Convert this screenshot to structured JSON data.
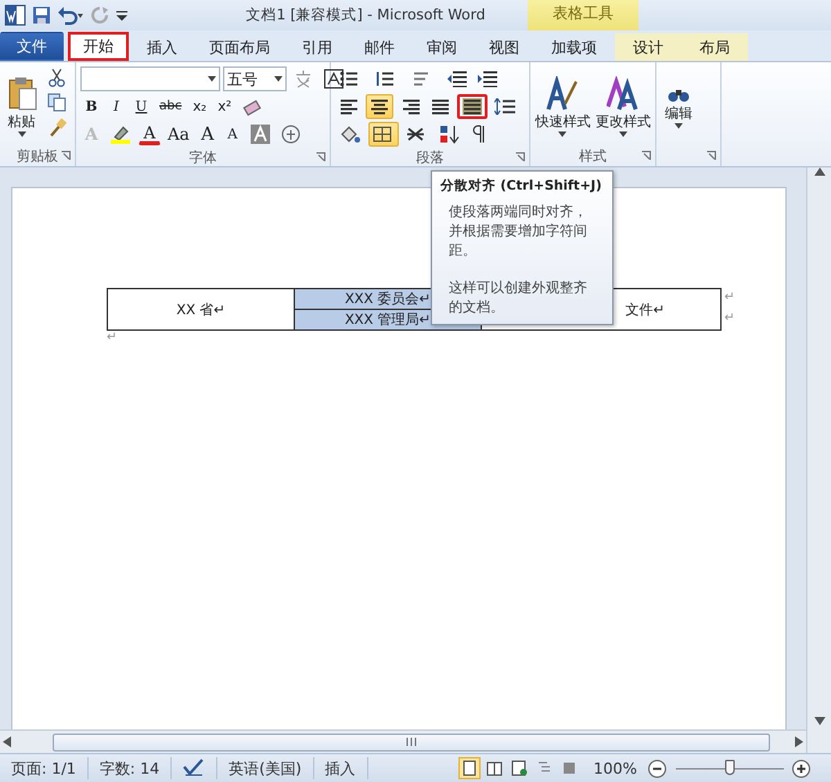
{
  "title_bar": {
    "title": "文档1 [兼容模式] - Microsoft Word",
    "contextual_group": "表格工具"
  },
  "tabs": [
    {
      "label": "文件",
      "kind": "file",
      "selected": false
    },
    {
      "label": "开始",
      "kind": "normal",
      "selected": true
    },
    {
      "label": "插入",
      "kind": "normal",
      "selected": false
    },
    {
      "label": "页面布局",
      "kind": "normal",
      "selected": false
    },
    {
      "label": "引用",
      "kind": "normal",
      "selected": false
    },
    {
      "label": "邮件",
      "kind": "normal",
      "selected": false
    },
    {
      "label": "审阅",
      "kind": "normal",
      "selected": false
    },
    {
      "label": "视图",
      "kind": "normal",
      "selected": false
    },
    {
      "label": "加载项",
      "kind": "normal",
      "selected": false
    },
    {
      "label": "设计",
      "kind": "contextual",
      "selected": false
    },
    {
      "label": "布局",
      "kind": "contextual",
      "selected": false
    }
  ],
  "ribbon": {
    "clipboard": {
      "label": "剪贴板",
      "paste": "粘贴"
    },
    "font": {
      "label": "字体",
      "size": "五号",
      "format_buttons": [
        "B",
        "I",
        "U",
        "abc",
        "x₂",
        "x²"
      ],
      "grow": "A",
      "shrink": "A",
      "case": "Aa",
      "font_color_letter": "A",
      "char_shade": "A"
    },
    "paragraph": {
      "label": "段落",
      "alignments": [
        {
          "kind": "left",
          "selected": false,
          "hovered": false
        },
        {
          "kind": "center",
          "selected": true,
          "hovered": false
        },
        {
          "kind": "right",
          "selected": false,
          "hovered": false
        },
        {
          "kind": "justify",
          "selected": false,
          "hovered": false
        },
        {
          "kind": "distributed",
          "selected": false,
          "hovered": true
        }
      ],
      "borders_selected": true
    },
    "styles": {
      "label": "样式",
      "buttons": [
        "快速样式",
        "更改样式"
      ]
    },
    "editing": {
      "label": "编辑"
    }
  },
  "tooltip": {
    "title": "分散对齐 (Ctrl+Shift+J)",
    "description": "使段落两端同时对齐，并根据需要增加字符间距。",
    "note": "这样可以创建外观整齐的文档。"
  },
  "table": {
    "left": {
      "text": "XX 省↵",
      "selected": false
    },
    "middle": [
      {
        "text": "XXX 委员会↵",
        "selected": true
      },
      {
        "text": "XXX 管理局↵",
        "selected": true
      }
    ],
    "right": {
      "text": "文件↵",
      "selected": false
    },
    "row_marks": [
      "↵",
      "↵"
    ],
    "after": "↵"
  },
  "status_bar": {
    "page": "页面: 1/1",
    "words": "字数: 14",
    "language": "英语(美国)",
    "mode": "插入",
    "views": [
      {
        "kind": "print",
        "selected": true
      },
      {
        "kind": "reading",
        "selected": false
      },
      {
        "kind": "web",
        "selected": false
      },
      {
        "kind": "outline",
        "selected": false
      },
      {
        "kind": "draft",
        "selected": false
      }
    ],
    "zoom": "100%",
    "zoom_slider": {
      "level": 0.5
    }
  }
}
